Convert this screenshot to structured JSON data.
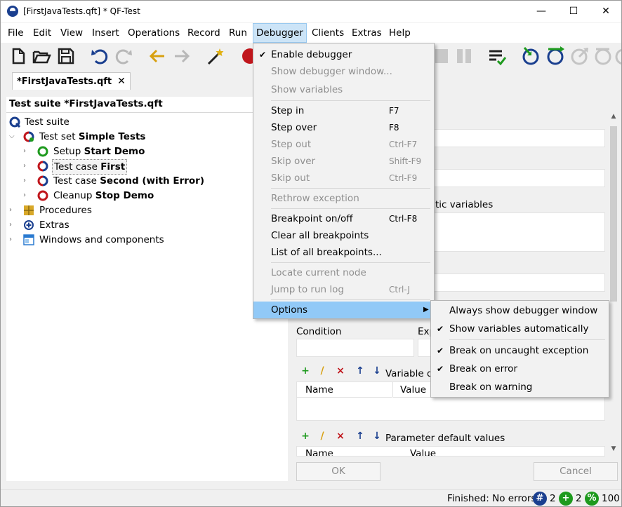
{
  "window": {
    "title": "[FirstJavaTests.qft] * QF-Test",
    "minimize": "—",
    "maximize": "☐",
    "close": "✕"
  },
  "menubar": {
    "items": [
      "File",
      "Edit",
      "View",
      "Insert",
      "Operations",
      "Record",
      "Run",
      "Debugger",
      "Clients",
      "Extras",
      "Help"
    ],
    "active": "Debugger"
  },
  "toolbar": {
    "icons": [
      "new-file-icon",
      "open-folder-icon",
      "save-icon",
      "undo-icon",
      "redo-icon",
      "back-arrow-icon",
      "forward-arrow-icon",
      "magic-wand-icon",
      "record-icon",
      "stop-icon",
      "pause-icon",
      "checklist-icon",
      "step-in-icon",
      "step-over-icon",
      "step-out-icon",
      "skip-over-icon",
      "skip-out-icon"
    ]
  },
  "tab": {
    "label": "*FirstJavaTests.qft",
    "close": "✕"
  },
  "tree": {
    "header": "Test suite *FirstJavaTests.qft",
    "root": "Test suite",
    "test_set_prefix": "Test set ",
    "test_set_name": "Simple Tests",
    "setup_prefix": "Setup ",
    "setup_name": "Start Demo",
    "case1_prefix": "Test case ",
    "case1_name": "First",
    "case2_prefix": "Test case ",
    "case2_name": "Second (with Error)",
    "cleanup_prefix": "Cleanup ",
    "cleanup_name": "Stop Demo",
    "procedures": "Procedures",
    "extras": "Extras",
    "windows": "Windows and components"
  },
  "details": {
    "static_vars_partial": "tic variables",
    "condition_label": "Condition",
    "exp_partial": "Exp",
    "variable_defs_partial": "Variable de",
    "name_col": "Name",
    "value_col": "Value",
    "param_defaults": "Parameter default values",
    "name_col2": "Name",
    "value_col2": "Value",
    "ok": "OK",
    "cancel": "Cancel"
  },
  "debugger_menu": {
    "enable_debugger": "Enable debugger",
    "show_debugger_window": "Show debugger window...",
    "show_variables": "Show variables",
    "step_in": "Step in",
    "step_in_sc": "F7",
    "step_over": "Step over",
    "step_over_sc": "F8",
    "step_out": "Step out",
    "step_out_sc": "Ctrl-F7",
    "skip_over": "Skip over",
    "skip_over_sc": "Shift-F9",
    "skip_out": "Skip out",
    "skip_out_sc": "Ctrl-F9",
    "rethrow": "Rethrow exception",
    "breakpoint": "Breakpoint on/off",
    "breakpoint_sc": "Ctrl-F8",
    "clear_breakpoints": "Clear all breakpoints",
    "list_breakpoints": "List of all breakpoints...",
    "locate_node": "Locate current node",
    "jump_log": "Jump to run log",
    "jump_log_sc": "Ctrl-J",
    "options": "Options"
  },
  "options_submenu": {
    "always_show": "Always show debugger window",
    "show_vars_auto": "Show variables automatically",
    "break_uncaught": "Break on uncaught exception",
    "break_error": "Break on error",
    "break_warning": "Break on warning"
  },
  "status": {
    "text": "Finished: No errors",
    "count1": "2",
    "count2": "2",
    "count3": "100"
  },
  "colors": {
    "menu_highlight": "#91c9f7",
    "menubar_active": "#cce4f7",
    "blue_icon": "#1a3f8f",
    "green_icon": "#1e9a1e",
    "red_icon": "#c0161c",
    "gold_icon": "#c99a1a"
  }
}
